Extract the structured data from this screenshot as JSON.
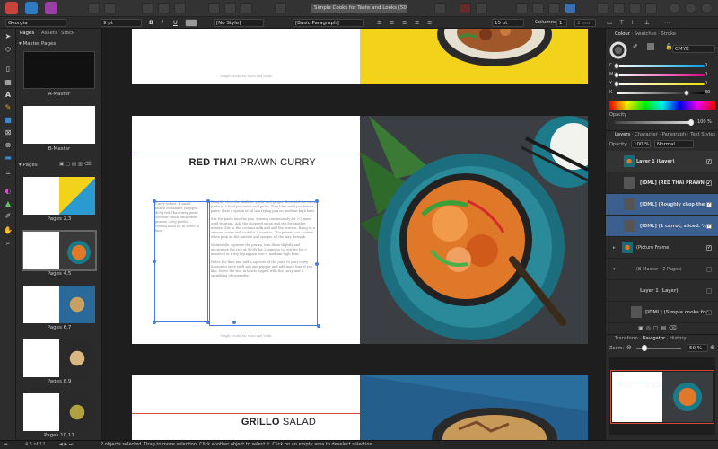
{
  "window": {
    "title": "Simple Cooks for Taste and Looks (50.0%)"
  },
  "context_bar": {
    "font": "Georgia",
    "font_size": "9 pt",
    "char_style": "[No Style]",
    "para_style": "[Basic Paragraph]",
    "leading": "15 pt",
    "columns_label": "Columns:",
    "columns_value": "1",
    "gutter": "2 mm"
  },
  "pages_panel": {
    "tabs": [
      "Pages",
      "Assets",
      "Stock"
    ],
    "master_section": "Master Pages",
    "masters": [
      "A-Master",
      "B-Master"
    ],
    "pages_section": "Pages",
    "spreads": [
      "Pages 2,3",
      "Pages 4,5",
      "Pages 6,7",
      "Pages 8,9",
      "Pages 10,11"
    ]
  },
  "canvas": {
    "footer_text": "Simple cooks for taste and looks",
    "spread2": {
      "heading_bold": "RED THAI",
      "heading_rest": "PRAWN CURRY",
      "col_a": "Curry serves: 4 small bunch coriander, chopped 400g red Thai curry paste coconut cream with extra prawns 250g peeled cooked head on to serve, a lime",
      "col_b": [
        "Roughly chop the shallots, garlic and ginger, then add the curry paste in a food processor and pulse, then blitz until you have a paste. Heat a splash of oil in a frying pan on medium-high heat.",
        "Stir the paste into the pan, stirring continuously for 2-3 mins until fragrant. Add the chopped onion and stir for another minute. Stir in the coconut milk and add the prawns. Bring to a simmer, cover and cook for 5 minutes. The prawns are cooked when pink on the outside and opaque all the way through.",
        "Meanwhile, squeeze the prawn, toss them slightly and microwave the rice at 800W for 2 minutes (or stir fry for 2 minutes) in a dry frying pan over a medium-high heat.",
        "Halve the lime and add a squeeze of the juice to your curry. Season to taste with salt and pepper and add more lime if you like. Serve the rice in bowls topped with the curry and a sprinkling of coriander."
      ]
    },
    "spread3": {
      "heading_bold": "GRILLO",
      "heading_rest": "SALAD"
    }
  },
  "right_panel": {
    "colour_tabs": [
      "Colour",
      "Swatches",
      "Stroke"
    ],
    "colour_model": "CMYK",
    "sliders": [
      {
        "label": "C",
        "value": "0"
      },
      {
        "label": "M",
        "value": "0"
      },
      {
        "label": "Y",
        "value": "0"
      },
      {
        "label": "K",
        "value": "80"
      }
    ],
    "slider_levels": [
      0,
      0,
      0,
      0.8
    ],
    "opacity_label": "Opacity",
    "opacity_value": "100 %",
    "layer_tabs": [
      "Layers",
      "Character",
      "Paragraph",
      "Text Styles"
    ],
    "layer_opacity_label": "Opacity:",
    "layer_opacity_value": "100 %",
    "blend_mode": "Normal",
    "layers": [
      {
        "name": "Layer 1 (Layer)"
      },
      {
        "name": "[IDML] (RED THAI PRAWN C"
      },
      {
        "name": "[IDML] (Roughly chop the s"
      },
      {
        "name": "[IDML] (1 carrot, sliced. ¼)"
      },
      {
        "name": "(Picture Frame)"
      },
      {
        "name": "(B-Master - 2 Pages)"
      },
      {
        "name": "Layer 1 (Layer)"
      },
      {
        "name": "[IDML] (Simple cooks for"
      }
    ],
    "nav_tabs": [
      "Transform",
      "Navigator",
      "History"
    ],
    "zoom_label": "Zoom:",
    "zoom_value": "50 %"
  },
  "status_bar": {
    "page_counter": "4,5 of 12",
    "message": "2 objects selected. Drag to move selection. Click another object to select it. Click on an empty area to deselect selection."
  },
  "colors": {
    "accent_red": "#d44a3a",
    "selection_blue": "#4a7bd8",
    "yellow": "#f2d21a"
  }
}
